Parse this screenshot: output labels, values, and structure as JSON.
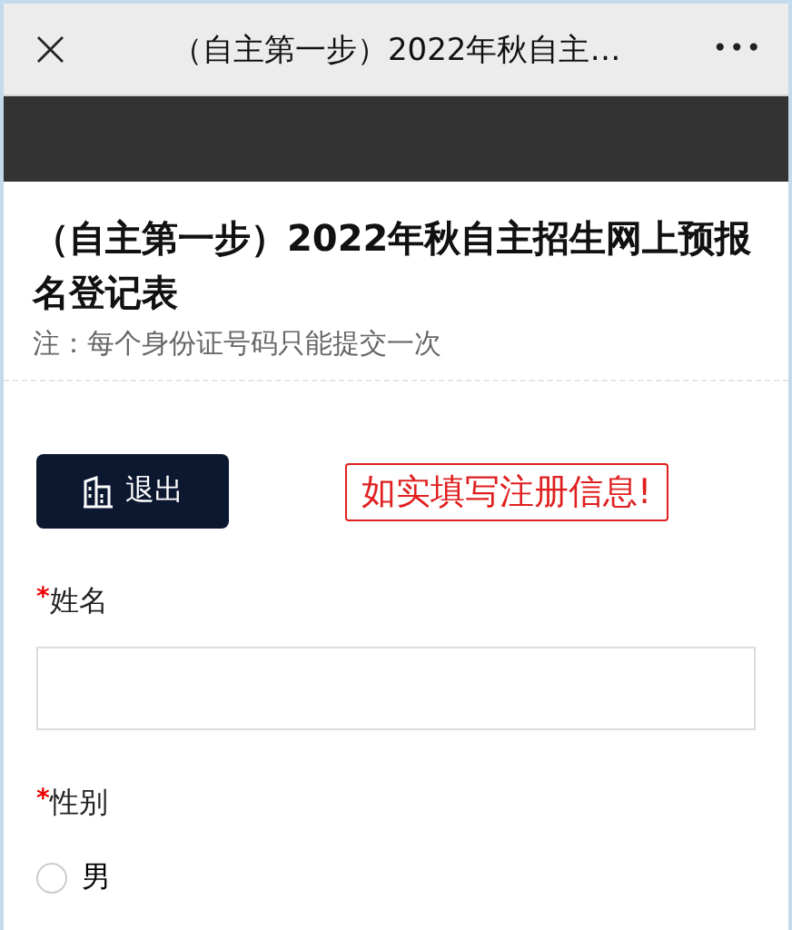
{
  "top_bar": {
    "close": "×",
    "title": "（自主第一步）2022年秋自主…",
    "menu": "•••"
  },
  "form": {
    "title": "（自主第一步）2022年秋自主招生网上预报名登记表",
    "note": "注：每个身份证号码只能提交一次"
  },
  "exit_button": {
    "label": "退出"
  },
  "notice": "如实填写注册信息!",
  "fields": [
    {
      "kind": "text",
      "required_mark": "*",
      "label": "姓名"
    },
    {
      "kind": "radio",
      "required_mark": "*",
      "label": "性别",
      "options": [
        {
          "label": "男",
          "selected": false
        }
      ]
    }
  ]
}
